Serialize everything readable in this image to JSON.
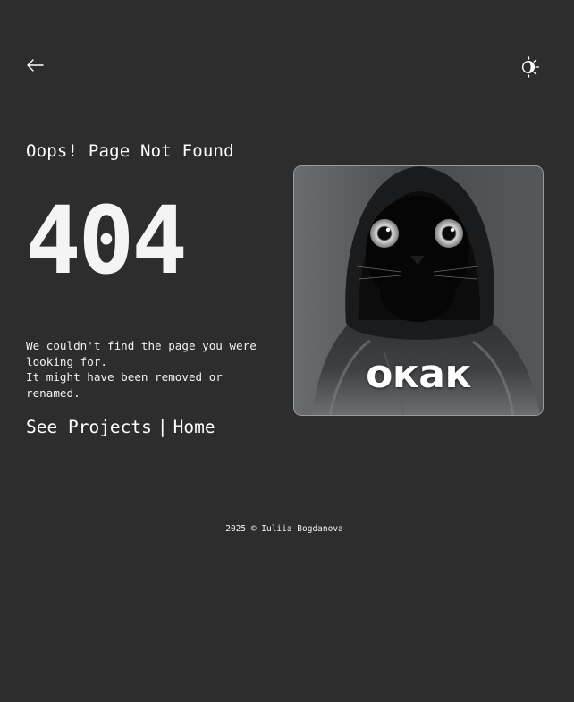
{
  "header": {
    "back_icon": "arrow-left-icon",
    "theme_icon": "sun-moon-theme-icon"
  },
  "main": {
    "subtitle": "Oops! Page Not Found",
    "code": "404",
    "message_line1": "We couldn't find the page you were looking for.",
    "message_line2": "It might have been removed or renamed.",
    "links": {
      "projects": "See Projects",
      "separator": "|",
      "home": "Home"
    },
    "image": {
      "caption": "окак",
      "subject": "black-cat-in-hoodie"
    }
  },
  "footer": {
    "text": "2025 © Iuliia Bogdanova"
  },
  "colors": {
    "background": "#2d2d2d",
    "text": "#ffffff",
    "image_border": "#9a9a9a"
  }
}
